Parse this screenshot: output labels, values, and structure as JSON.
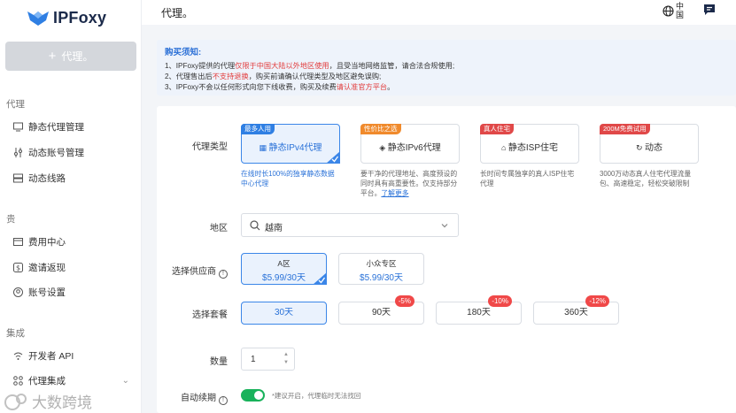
{
  "sidebar": {
    "logo": "IPFoxy",
    "new_button": "代理。",
    "sections": [
      "代理",
      "贵",
      "集成"
    ],
    "items": [
      {
        "label": "静态代理管理",
        "icon": "monitor-icon"
      },
      {
        "label": "动态账号管理",
        "icon": "sliders-icon"
      },
      {
        "label": "动态线路",
        "icon": "server-icon"
      },
      {
        "label": "费用中心",
        "icon": "wallet-icon"
      },
      {
        "label": "邀请返现",
        "icon": "dollar-icon"
      },
      {
        "label": "账号设置",
        "icon": "user-circle-icon"
      },
      {
        "label": "开发者 API",
        "icon": "wifi-icon"
      },
      {
        "label": "代理集成",
        "icon": "integration-icon"
      }
    ],
    "watermark": "大数跨境"
  },
  "header": {
    "title": "代理。",
    "language": "中国",
    "icons": [
      "globe-icon",
      "message-icon"
    ]
  },
  "notice": {
    "title": "购买须知:",
    "line1_pre": "1、IPFoxy提供的代理",
    "line1_red": "仅限于中国大陆以外地区使用",
    "line1_post": "，且受当地网络监管，请合法合规使用;",
    "line2_pre": "2、代理售出后",
    "line2_red": "不支持退换",
    "line2_post": "，购买前请确认代理类型及地区避免误购;",
    "line3_pre": "3、IPFoxy不会以任何形式向您下线收费，购买及续费",
    "line3_red": "请认准官方平台",
    "line3_post": "。"
  },
  "form": {
    "type_label": "代理类型",
    "types": [
      {
        "badge": "最多人用",
        "badge_color": "#2f7fe3",
        "name": "静态IPv4代理",
        "icon": "grid-icon",
        "desc": "在线时长100%的独享静态数据中心代理"
      },
      {
        "badge": "性价比之选",
        "badge_color": "#f08a2c",
        "name": "静态IPv6代理",
        "icon": "layers-icon",
        "desc": "要干净的代理地址、高度预设的同时具有高重要性。仅支持部分平台。",
        "link": "了解更多"
      },
      {
        "badge": "真人住宅",
        "badge_color": "#e04848",
        "name": "静态ISP住宅",
        "icon": "home-icon",
        "desc": "长时间专属独享的真人ISP住宅代理"
      },
      {
        "badge": "200M免费试用",
        "badge_color": "#e04848",
        "name": "动态",
        "icon": "refresh-icon",
        "desc": "3000万动态真人住宅代理流量包、高速稳定，轻松突破限制"
      }
    ],
    "region_label": "地区",
    "region_value": "越南",
    "supplier_label": "选择供应商",
    "suppliers": [
      {
        "name": "A区",
        "price": "$5.99/30天"
      },
      {
        "name": "小众专区",
        "price": "$5.99/30天"
      }
    ],
    "plan_label": "选择套餐",
    "plans": [
      {
        "label": "30天",
        "discount": ""
      },
      {
        "label": "90天",
        "discount": "-5%"
      },
      {
        "label": "180天",
        "discount": "-10%"
      },
      {
        "label": "360天",
        "discount": "-12%"
      }
    ],
    "qty_label": "数量",
    "qty_value": "1",
    "auto_label": "自动续期",
    "auto_hint": "*建议开启，代理临时无法找回"
  }
}
